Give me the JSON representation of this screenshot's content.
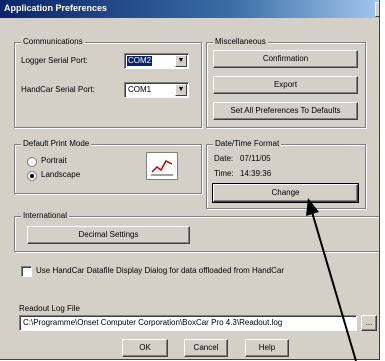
{
  "window": {
    "title": "Application Preferences",
    "close_glyph": "x"
  },
  "communications": {
    "legend": "Communications",
    "logger_port_label": "Logger Serial Port:",
    "logger_port_value": "COM2",
    "handcar_port_label": "HandCar Serial Port:",
    "handcar_port_value": "COM1"
  },
  "miscellaneous": {
    "legend": "Miscellaneous",
    "confirmation": "Confirmation",
    "export": "Export",
    "set_defaults": "Set All Preferences To Defaults"
  },
  "print_mode": {
    "legend": "Default Print Mode",
    "portrait": "Portrait",
    "landscape": "Landscape",
    "selected": "Landscape"
  },
  "datetime": {
    "legend": "Date/Time Format",
    "date_label": "Date:",
    "date_value": "07/11/05",
    "time_label": "Time:",
    "time_value": "14:39:36",
    "change": "Change"
  },
  "international": {
    "legend": "International",
    "decimal_settings": "Decimal Settings"
  },
  "datafile_checkbox": {
    "label": "Use HandCar Datafile Display Dialog for data offloaded from HandCar",
    "checked": false
  },
  "readout_log": {
    "label": "Readout Log File",
    "path": "C:\\Programme\\Onset Computer Corporation\\BoxCar Pro 4.3\\Readout.log",
    "browse": "..."
  },
  "footer": {
    "ok": "OK",
    "cancel": "Cancel",
    "help": "Help"
  },
  "icons": [
    "close-icon",
    "dropdown-arrow-icon",
    "chart-icon",
    "annotation-arrow"
  ]
}
